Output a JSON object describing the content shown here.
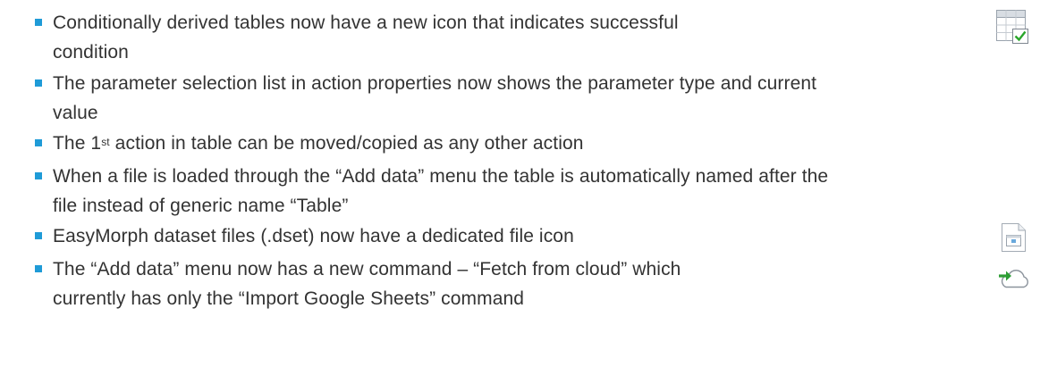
{
  "items": [
    {
      "lines": [
        "Conditionally derived tables now have a new icon that indicates successful",
        "condition"
      ],
      "icon": "table-check-icon"
    },
    {
      "lines": [
        "The parameter selection list in action properties now shows the parameter type and current",
        "value"
      ]
    },
    {
      "pre": "The 1",
      "sup": "st",
      "post": " action in table can be moved/copied as any other action"
    },
    {
      "lines": [
        "When a file is loaded through the “Add data” menu the table is automatically named after the",
        "file instead of generic name “Table”"
      ]
    },
    {
      "lines": [
        "EasyMorph dataset files (.dset) now have a dedicated file icon"
      ],
      "icon": "dataset-file-icon"
    },
    {
      "lines": [
        "The “Add data” menu now has a new command – “Fetch from cloud” which",
        "currently has only the “Import Google Sheets” command"
      ],
      "icon": "cloud-fetch-icon"
    }
  ],
  "colors": {
    "bullet": "#1f9bd7",
    "text": "#333333",
    "check": "#2aa62a",
    "arrow": "#2e9e35"
  }
}
